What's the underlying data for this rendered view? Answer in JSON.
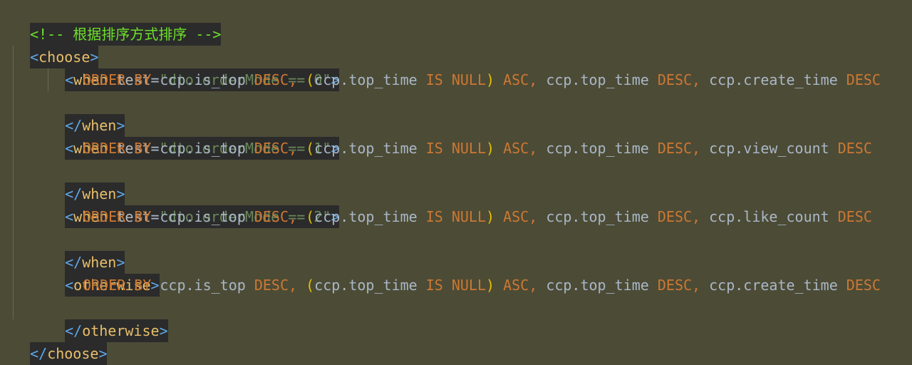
{
  "comment": "<!-- 根据排序方式排序 -->",
  "choose_open": "choose",
  "choose_close": "choose",
  "when_tag": "when",
  "otherwise_tag": "otherwise",
  "test_attr": "test",
  "conditions": [
    "\"dto.orderMode == 0\"",
    "\"dto.orderMode == 1\"",
    "\"dto.orderMode == 2\""
  ],
  "sql": {
    "order_by": "ORDER BY",
    "is_top": "ccp.is_top",
    "desc": "DESC",
    "is_null": "IS NULL",
    "asc": "ASC",
    "top_time": "ccp.top_time",
    "lines_last_col": [
      "ccp.create_time",
      "ccp.view_count",
      "ccp.like_count",
      "ccp.create_time"
    ]
  }
}
